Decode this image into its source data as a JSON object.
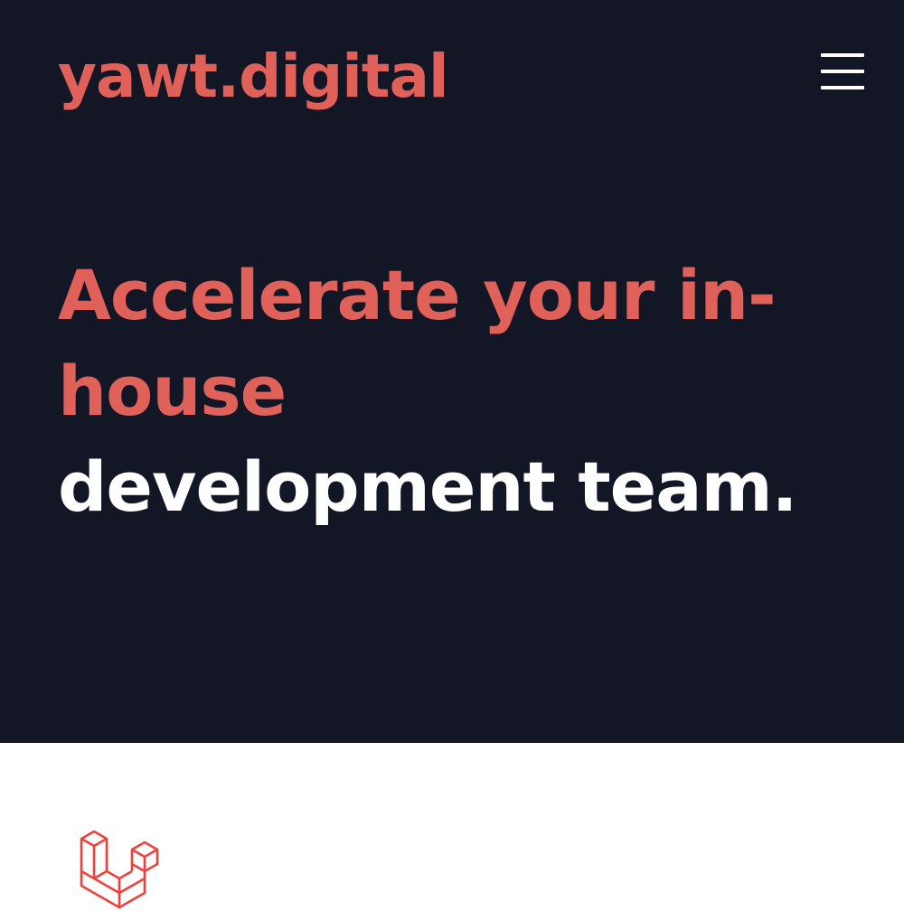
{
  "header": {
    "logo_text": "yawt.digital",
    "menu_icon": "hamburger-menu-icon"
  },
  "hero": {
    "headline_accent_line1": "Accelerate your in-",
    "headline_accent_line2": "house",
    "headline_plain": "development team."
  },
  "content": {
    "logo_icon": "laravel-logo-icon"
  },
  "colors": {
    "background_dark": "#131625",
    "accent": "#e0605a",
    "text_light": "#ffffff",
    "background_light": "#ffffff",
    "laravel_red": "#f0413a"
  }
}
